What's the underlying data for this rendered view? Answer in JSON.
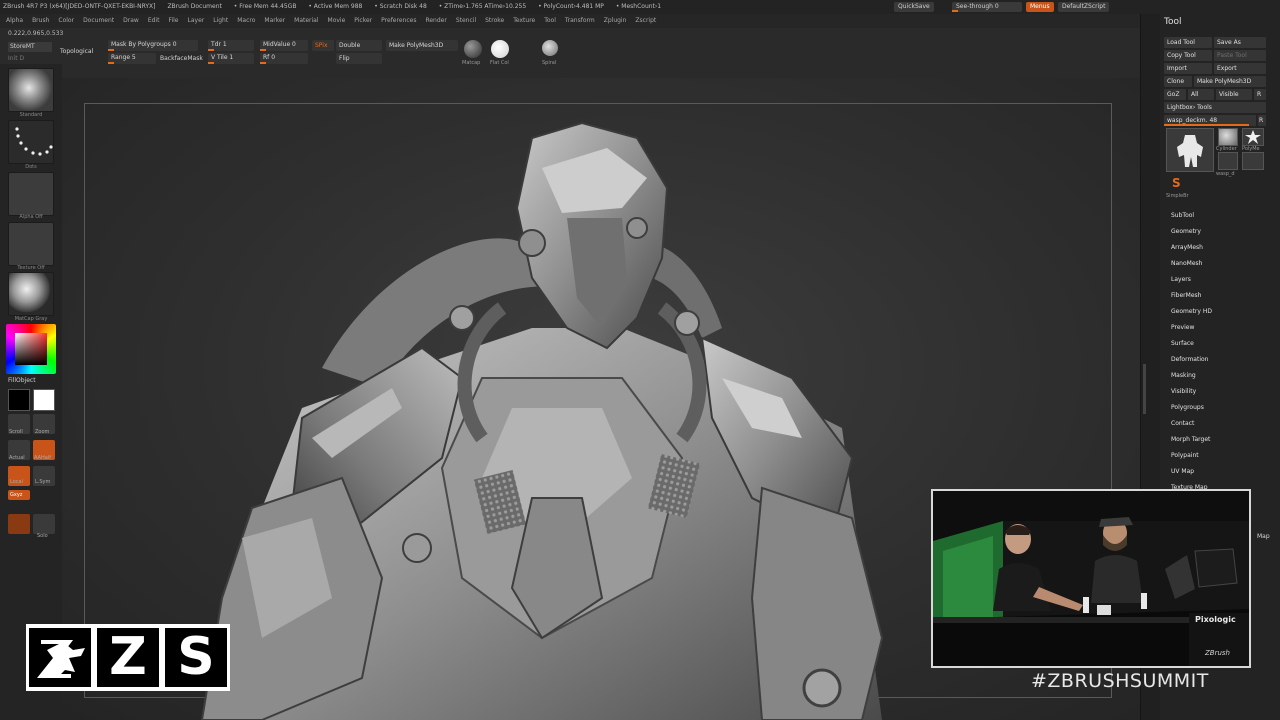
{
  "titlebar": {
    "app": "ZBrush 4R7 P3 (x64)[JDED-ONTF-QXET-EKBI-NRYX]",
    "document": "ZBrush Document",
    "free_mem": "• Free Mem 44.45GB",
    "active_mem": "• Active Mem 988",
    "scratch": "• Scratch Disk 48",
    "ztime": "• ZTime›1.765 ATime›10.255",
    "polycount": "• PolyCount›4.481 MP",
    "meshcount": "• MeshCount›1",
    "quicksave": "QuickSave",
    "seethrough": "See-through  0",
    "menus_btn": "Menus",
    "default_script": "DefaultZScript"
  },
  "menubar": {
    "items": [
      "Alpha",
      "Brush",
      "Color",
      "Document",
      "Draw",
      "Edit",
      "File",
      "Layer",
      "Light",
      "Macro",
      "Marker",
      "Material",
      "Movie",
      "Picker",
      "Preferences",
      "Render",
      "Stencil",
      "Stroke",
      "Texture",
      "Tool",
      "Transform",
      "Zplugin",
      "Zscript"
    ]
  },
  "shelf": {
    "coords": "0.222,0.965,0.533",
    "store_mt": "StoreMT",
    "hint": "Init D",
    "topological": "Topological",
    "mask_by_polygroups": "Mask By Polygroups 0",
    "range": "Range 5",
    "tdr": "Tdr 1",
    "backface_mask": "BackfaceMask",
    "v_tile": "V Tile 1",
    "midvalue": "MidValue 0",
    "rf": "Rf 0",
    "spix": "SPix",
    "double": "Double",
    "flip": "Flip",
    "make_polymesh": "Make PolyMesh3D",
    "material_lbl": "Matcap",
    "flat_lbl": "Flat Col",
    "spiral_lbl": "Spiral",
    "seethrough_fraction": 0
  },
  "lefttray": {
    "brush_lbl": "Standard",
    "stroke_lbl": "Dots",
    "alpha_lbl": "Alpha Off",
    "texture_lbl": "Texture Off",
    "material_lbl": "MatCap Gray",
    "fill_object": "FillObject",
    "scroll_lbl": "Scroll",
    "zoom_lbl": "Zoom",
    "actual_lbl": "Actual",
    "aahalf_lbl": "AAHalf",
    "local_lbl": "Local",
    "lsym_lbl": "L.Sym",
    "gxyz_lbl": "Gxyz",
    "solo_lbl": "Solo"
  },
  "tool": {
    "title": "Tool",
    "load_tool": "Load Tool",
    "save_as": "Save As",
    "copy_tool": "Copy Tool",
    "paste_tool": "Paste Tool",
    "import": "Import",
    "export": "Export",
    "clone": "Clone",
    "make_polymesh": "Make PolyMesh3D",
    "goz": "GoZ",
    "all": "All",
    "visible": "Visible",
    "r": "R",
    "lightbox_tools": "Lightbox› Tools",
    "current_tool": "wasp_deckm. 48",
    "current_tool_fraction": 0.92,
    "cylinder": "Cylinder",
    "polymesh": "PolyMe",
    "simple_brush": "SimpleBr",
    "wasp_short": "wasp_d",
    "menu": [
      "SubTool",
      "Geometry",
      "ArrayMesh",
      "NanoMesh",
      "Layers",
      "FiberMesh",
      "Geometry HD",
      "Preview",
      "Surface",
      "Deformation",
      "Masking",
      "Visibility",
      "Polygroups",
      "Contact",
      "Morph Target",
      "Polypaint",
      "UV Map",
      "Texture Map"
    ],
    "side_word": "Map"
  },
  "overlay": {
    "logo_z": "Z",
    "logo_s": "S",
    "hashtag": "#ZBRUSHSUMMIT",
    "banner_text": "Pixologic",
    "banner_sub": "ZBrush"
  }
}
